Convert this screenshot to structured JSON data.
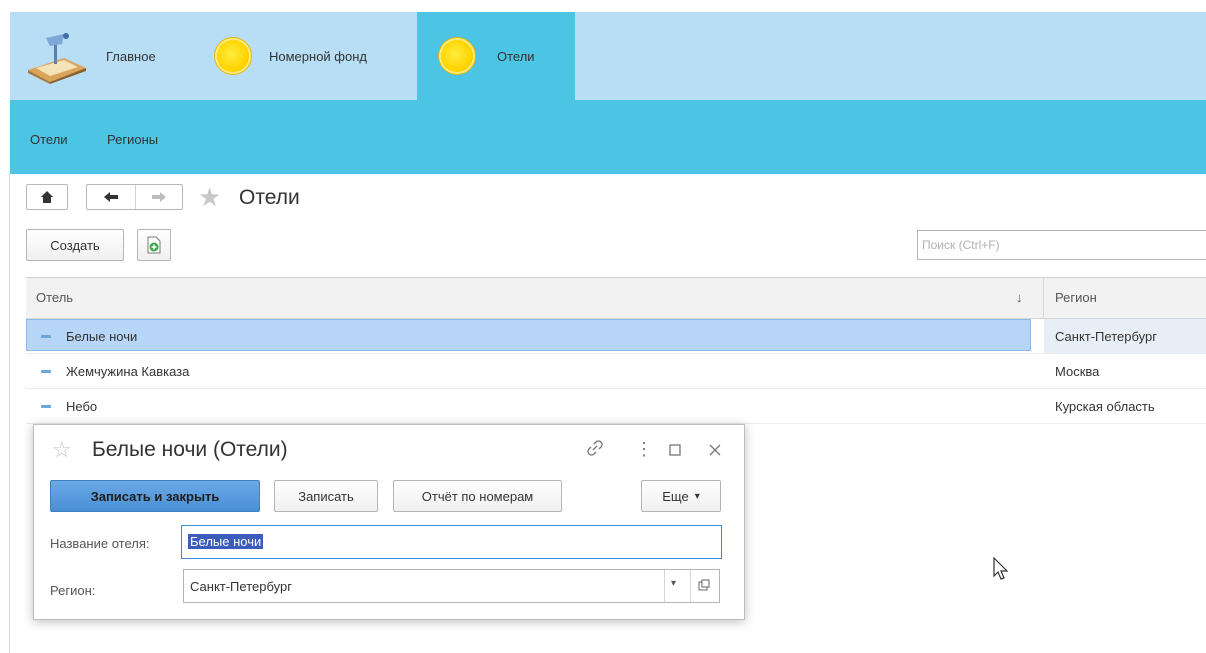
{
  "sections": [
    {
      "label": "Главное",
      "icon": "desk-lamp-icon",
      "active": false
    },
    {
      "label": "Номерной фонд",
      "icon": "coin-icon",
      "active": false
    },
    {
      "label": "Отели",
      "icon": "coin-icon",
      "active": true
    }
  ],
  "subnav": [
    "Отели",
    "Регионы"
  ],
  "page": {
    "title": "Отели"
  },
  "toolbar": {
    "create_label": "Создать",
    "search_placeholder": "Поиск (Ctrl+F)"
  },
  "table": {
    "columns": [
      "Отель",
      "Регион"
    ],
    "sort_indicator": "↓",
    "rows": [
      {
        "hotel": "Белые ночи",
        "region": "Санкт-Петербург",
        "selected": true
      },
      {
        "hotel": "Жемчужина Кавказа",
        "region": "Москва",
        "selected": false
      },
      {
        "hotel": "Небо",
        "region": "Курская область",
        "selected": false
      }
    ]
  },
  "dialog": {
    "title": "Белые ночи (Отели)",
    "buttons": {
      "save_close": "Записать и закрыть",
      "save": "Записать",
      "report": "Отчёт по номерам",
      "more": "Еще"
    },
    "fields": {
      "name_label": "Название отеля:",
      "name_value": "Белые ночи",
      "region_label": "Регион:",
      "region_value": "Санкт-Петербург"
    }
  },
  "colors": {
    "section_bar": "#b7def4",
    "accent": "#4cc4e3",
    "selection": "#b7d6f7",
    "primary_button": "#4a8fd6"
  }
}
